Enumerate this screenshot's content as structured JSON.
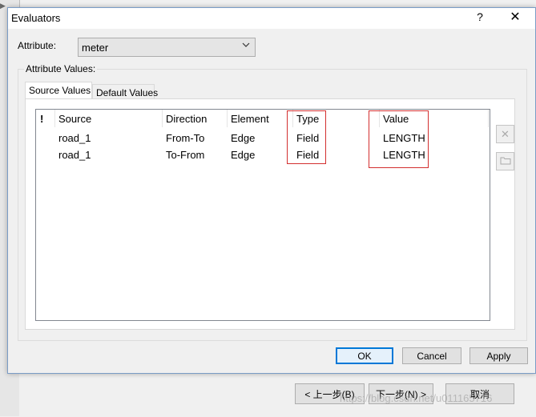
{
  "dialog": {
    "title": "Evaluators",
    "help_label": "?",
    "close_label": "✕"
  },
  "attribute": {
    "label": "Attribute:",
    "selected": "meter"
  },
  "group": {
    "label": "Attribute Values:"
  },
  "tabs": [
    {
      "label": "Source Values",
      "active": true
    },
    {
      "label": "Default Values",
      "active": false
    }
  ],
  "table": {
    "columns": [
      "!",
      "Source",
      "Direction",
      "Element",
      "Type",
      "Value"
    ],
    "rows": [
      {
        "source": "road_1",
        "direction": "From-To",
        "element": "Edge",
        "type": "Field",
        "value": "LENGTH"
      },
      {
        "source": "road_1",
        "direction": "To-From",
        "element": "Edge",
        "type": "Field",
        "value": "LENGTH"
      }
    ]
  },
  "side_buttons": {
    "delete_icon": "x-icon",
    "properties_icon": "folder-icon"
  },
  "buttons": {
    "ok": "OK",
    "cancel": "Cancel",
    "apply": "Apply"
  },
  "background_wizard": {
    "back": "< 上一步(B)",
    "next": "下一步(N) >",
    "cancel": "取消"
  },
  "watermark": "https://blog.csdn.net/u011165716",
  "colors": {
    "highlight": "#d32f2f",
    "default_button_border": "#0078d7"
  }
}
